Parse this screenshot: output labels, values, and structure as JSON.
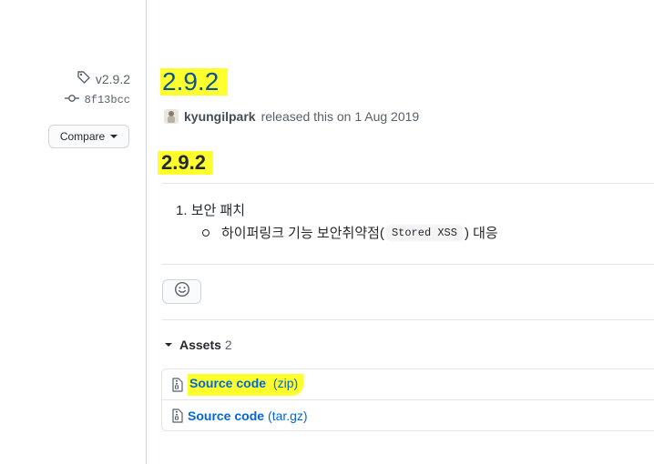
{
  "sidebar": {
    "tag": "v2.9.2",
    "commit": "8f13bcc",
    "compare_label": "Compare"
  },
  "release": {
    "title": "2.9.2",
    "author": "kyungilpark",
    "released_text": "released this on 1 Aug 2019"
  },
  "notes": {
    "heading": "2.9.2",
    "item_number": "1.",
    "item_text": "보안 패치",
    "sub_before": "하이퍼링크 기능 보안취약점(",
    "sub_code": "Stored XSS",
    "sub_after": ") 대응"
  },
  "assets": {
    "label": "Assets",
    "count": "2",
    "items": [
      {
        "name": "Source code",
        "ext": "(zip)"
      },
      {
        "name": "Source code",
        "ext": "(tar.gz)"
      }
    ]
  },
  "colors": {
    "highlight": "#ffff2e",
    "link": "#0366d6",
    "title": "#0b5394"
  }
}
